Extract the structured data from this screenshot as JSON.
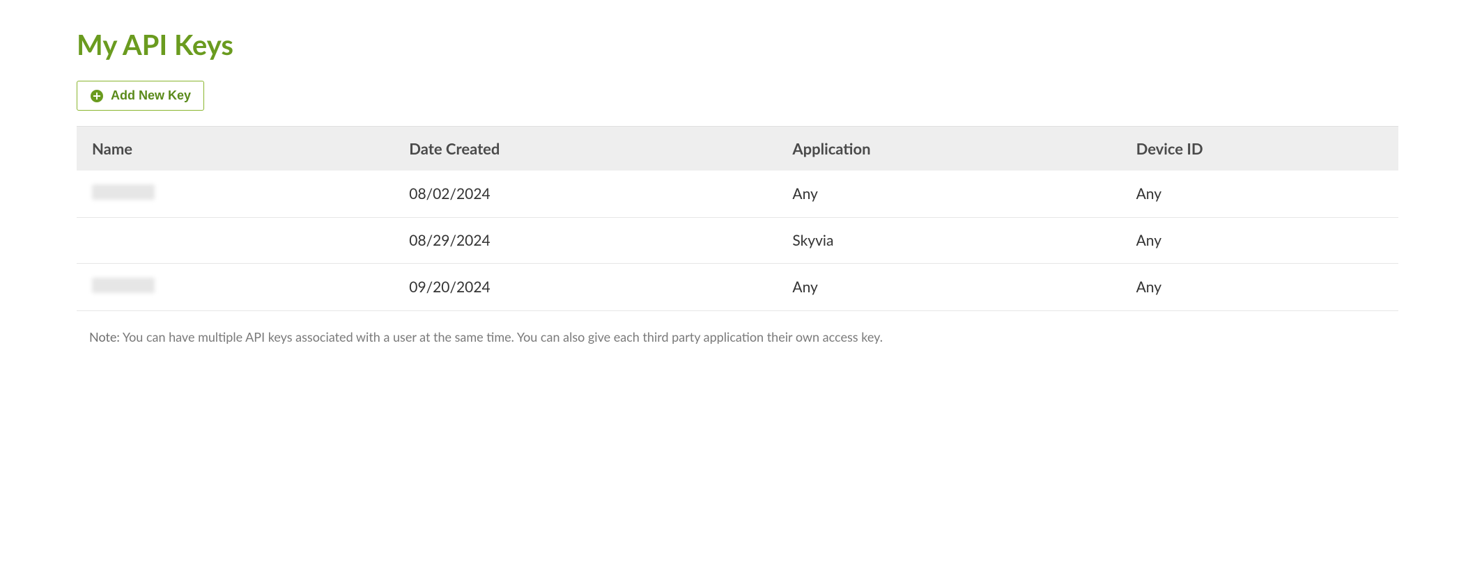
{
  "page": {
    "title": "My API Keys"
  },
  "actions": {
    "add_new_key_label": "Add New Key"
  },
  "table": {
    "headers": {
      "name": "Name",
      "date_created": "Date Created",
      "application": "Application",
      "device_id": "Device ID"
    },
    "rows": [
      {
        "name_redacted": true,
        "name": "",
        "date_created": "08/02/2024",
        "application": "Any",
        "device_id": "Any"
      },
      {
        "name_redacted": false,
        "name": "",
        "date_created": "08/29/2024",
        "application": "Skyvia",
        "device_id": "Any"
      },
      {
        "name_redacted": true,
        "name": "",
        "date_created": "09/20/2024",
        "application": "Any",
        "device_id": "Any"
      }
    ]
  },
  "note": {
    "label": "Note:",
    "text": "You can have multiple API keys associated with a user at the same time. You can also give each third party application their own access key."
  },
  "colors": {
    "accent": "#6a9b1f",
    "button_border": "#8ab52e"
  }
}
